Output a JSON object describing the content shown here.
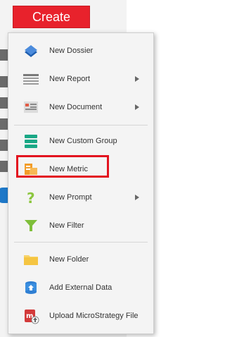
{
  "create": {
    "label": "Create"
  },
  "menu": {
    "items": [
      {
        "label": "New Dossier",
        "icon": "dossier-icon",
        "submenu": false
      },
      {
        "label": "New Report",
        "icon": "report-icon",
        "submenu": true
      },
      {
        "label": "New Document",
        "icon": "document-icon",
        "submenu": true
      },
      {
        "label": "New Custom Group",
        "icon": "custom-group-icon",
        "submenu": false
      },
      {
        "label": "New Metric",
        "icon": "metric-icon",
        "submenu": false,
        "highlighted": true
      },
      {
        "label": "New Prompt",
        "icon": "prompt-icon",
        "submenu": true
      },
      {
        "label": "New Filter",
        "icon": "filter-icon",
        "submenu": false
      },
      {
        "label": "New Folder",
        "icon": "folder-icon",
        "submenu": false
      },
      {
        "label": "Add External Data",
        "icon": "database-icon",
        "submenu": false
      },
      {
        "label": "Upload MicroStrategy File",
        "icon": "upload-file-icon",
        "submenu": false
      }
    ]
  },
  "colors": {
    "create_button": "#e8222c",
    "highlight_border": "#e3131f",
    "menu_background": "#f4f4f4"
  }
}
